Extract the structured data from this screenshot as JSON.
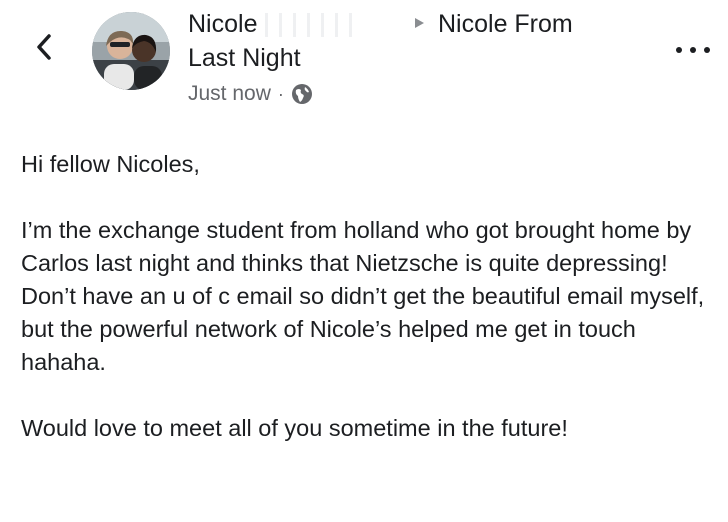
{
  "post": {
    "author_first": "Nicole",
    "author_second_line": "Last Night",
    "target_group": "Nicole From",
    "time": "Just now",
    "separator": "·",
    "privacy_icon": "globe-icon",
    "greeting": "Hi fellow Nicoles,",
    "body": "I’m the exchange student from holland who got brought home by Carlos last night and thinks that Nietzsche is quite depressing! Don’t have an u of c email so didn’t get the beautiful email myself, but the powerful network of Nicole’s helped me get in touch hahaha.",
    "closing": "Would love to meet all of you sometime in the future!"
  },
  "icons": {
    "back": "chevron-left-icon",
    "more": "more-dots-icon",
    "arrow": "share-arrow-icon"
  },
  "colors": {
    "text": "#1c1e21",
    "secondary": "#65676b"
  }
}
